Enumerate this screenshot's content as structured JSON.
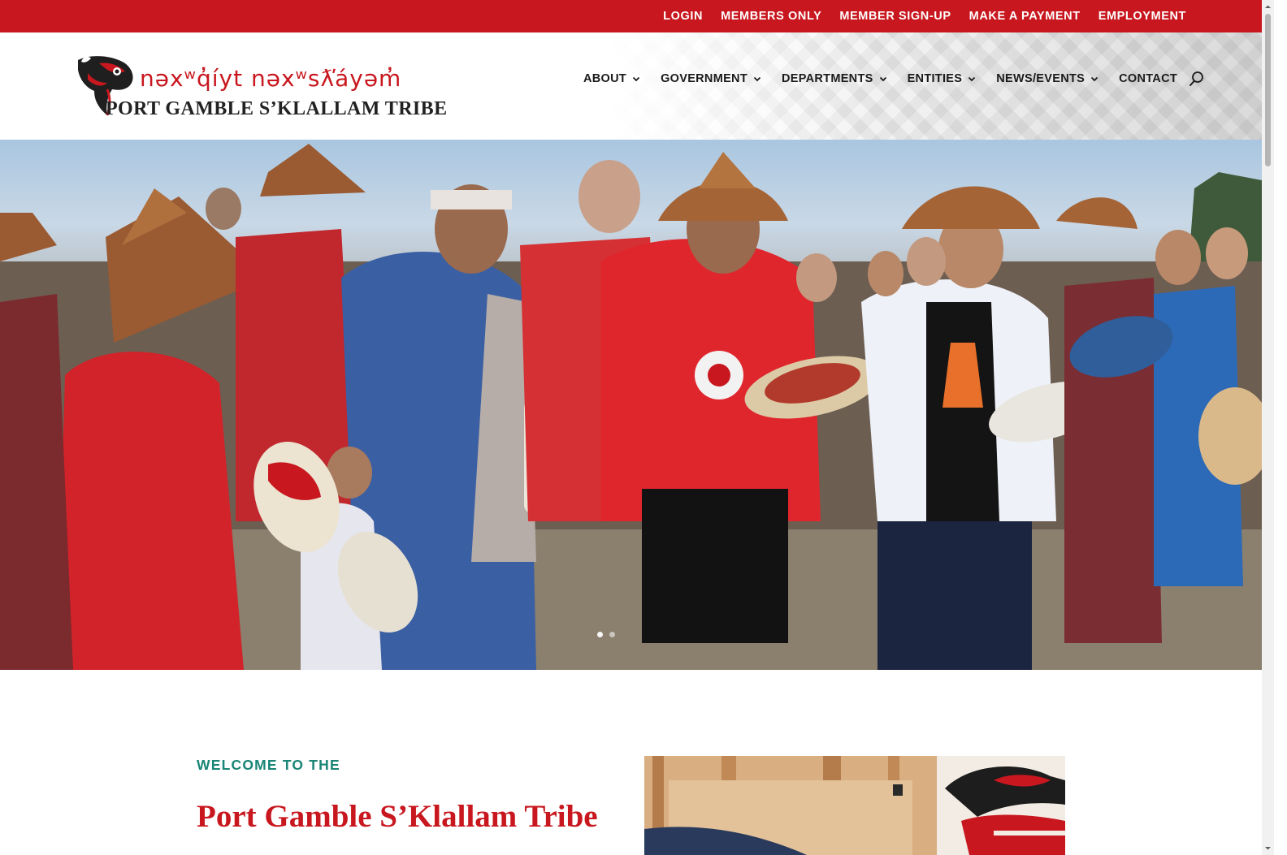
{
  "topbar": {
    "links": [
      "LOGIN",
      "MEMBERS ONLY",
      "MEMBER SIGN-UP",
      "MAKE A PAYMENT",
      "EMPLOYMENT"
    ]
  },
  "header": {
    "logo": {
      "native_name": "nəxʷq̓íyt nəxʷsƛ̕áyəm̓",
      "name": "PORT GAMBLE S’KLALLAM TRIBE"
    },
    "nav": [
      {
        "label": "ABOUT"
      },
      {
        "label": "GOVERNMENT"
      },
      {
        "label": "DEPARTMENTS"
      },
      {
        "label": "ENTITIES"
      },
      {
        "label": "NEWS/EVENTS"
      },
      {
        "label": "CONTACT"
      }
    ],
    "search_icon": "search-icon"
  },
  "welcome": {
    "eyebrow": "WELCOME TO THE",
    "title": "Port Gamble S’Klallam Tribe"
  },
  "colors": {
    "brand_red": "#c8171e",
    "teal": "#1a8576",
    "text_dark": "#1a1a1a"
  }
}
